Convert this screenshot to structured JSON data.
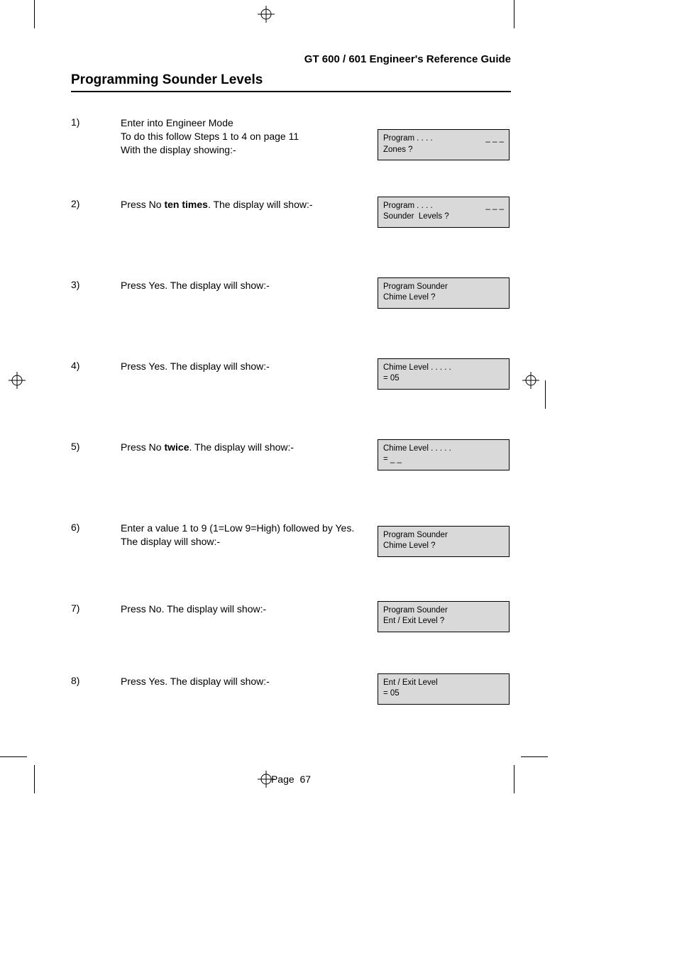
{
  "header": {
    "running": "GT 600 / 601 Engineer's Reference Guide",
    "section": "Programming Sounder Levels"
  },
  "steps": [
    {
      "num": "1)",
      "text": "Enter into Engineer Mode\nTo do this follow Steps 1 to 4 on page 11\nWith the display showing:-",
      "lcd_l1": "Program . . . .",
      "lcd_dash": "_ _ _",
      "lcd_l2": "Zones ?"
    },
    {
      "num": "2)",
      "text_pre": "Press No ",
      "text_bold": "ten times",
      "text_post": ". The display will show:-",
      "lcd_l1": "Program . . . .",
      "lcd_dash": "_ _ _",
      "lcd_l2": "Sounder  Levels ?"
    },
    {
      "num": "3)",
      "text": "Press Yes. The display will show:-",
      "lcd_l1": "Program Sounder",
      "lcd_l2": "Chime Level ?"
    },
    {
      "num": "4)",
      "text": "Press Yes. The display will show:-",
      "lcd_l1": "Chime Level . . . . .",
      "lcd_l2": "= 05"
    },
    {
      "num": "5)",
      "text_pre": "Press No ",
      "text_bold": "twice",
      "text_post": ". The display will show:-",
      "lcd_l1": "Chime Level . . . . .",
      "lcd_l2": "= _ _"
    },
    {
      "num": "6)",
      "text": "Enter a value 1 to 9 (1=Low 9=High) followed by Yes. The display will show:-",
      "lcd_l1": "Program Sounder",
      "lcd_l2": "Chime Level ?"
    },
    {
      "num": "7)",
      "text": "Press No. The display will show:-",
      "lcd_l1": "Program Sounder",
      "lcd_l2": "Ent / Exit Level ?"
    },
    {
      "num": "8)",
      "text": "Press Yes. The display will show:-",
      "lcd_l1": "Ent / Exit Level",
      "lcd_l2": "= 05"
    }
  ],
  "footer": {
    "label": "Page",
    "number": "67"
  }
}
